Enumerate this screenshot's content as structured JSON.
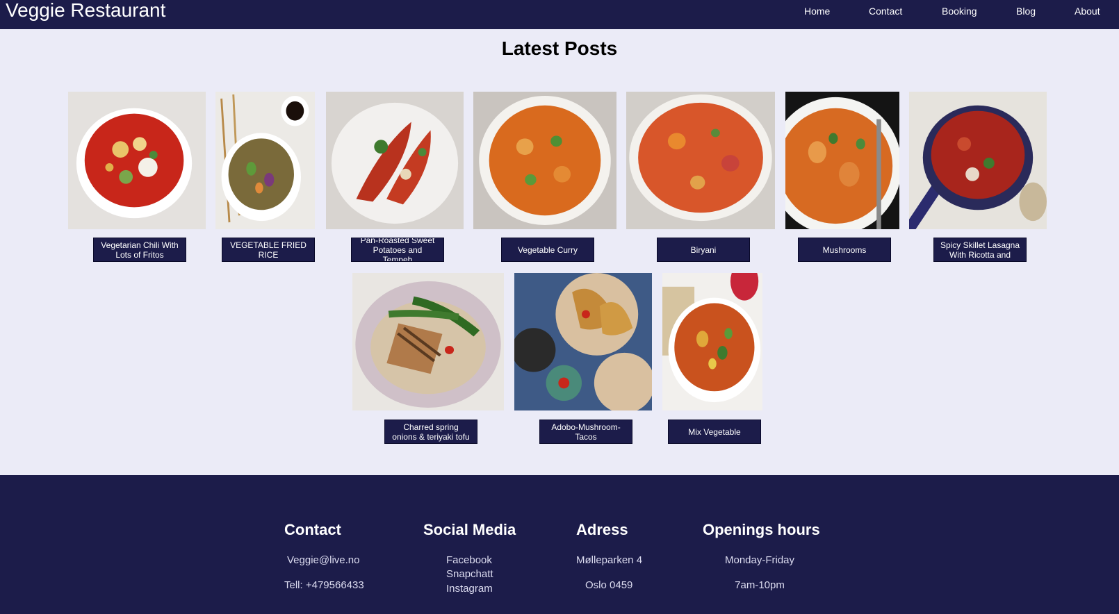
{
  "header": {
    "brand": "Veggie Restaurant",
    "nav": [
      "Home",
      "Contact",
      "Booking",
      "Blog",
      "About"
    ]
  },
  "main": {
    "title": "Latest Posts",
    "posts": [
      {
        "label": "Vegetarian Chili With Lots of Fritos",
        "image": "bowl-of-chili"
      },
      {
        "label": "VEGETABLE FRIED RICE",
        "image": "bowl-of-fried-rice-with-chopsticks"
      },
      {
        "label": "Pan-Roasted Sweet Potatoes and Tempeh",
        "image": "plate-of-roasted-sweet-potatoes"
      },
      {
        "label": "Vegetable Curry",
        "image": "bowl-of-vegetable-curry"
      },
      {
        "label": "Biryani",
        "image": "bowl-of-biryani"
      },
      {
        "label": "Mushrooms",
        "image": "bowl-of-mushroom-dish"
      },
      {
        "label": "Spicy Skillet Lasagna With Ricotta and Spinach",
        "image": "skillet-lasagna"
      },
      {
        "label": "Charred spring onions & teriyaki tofu",
        "image": "plate-of-tofu-with-spring-onions"
      },
      {
        "label": "Adobo-Mushroom-Tacos",
        "image": "plates-of-tacos"
      },
      {
        "label": "Mix Vegetable",
        "image": "bowl-of-mixed-vegetables"
      }
    ]
  },
  "footer": {
    "contact": {
      "heading": "Contact",
      "email": "Veggie@live.no",
      "phone": "Tell: +479566433"
    },
    "social": {
      "heading": "Social Media",
      "links": [
        "Facebook",
        "Snapchatt",
        "Instagram"
      ]
    },
    "address": {
      "heading": "Adress",
      "street": "Mølleparken 4",
      "city": "Oslo 0459"
    },
    "hours": {
      "heading": "Openings hours",
      "days": "Monday-Friday",
      "time": "7am-10pm"
    }
  },
  "colors": {
    "navy": "#1c1c4a",
    "page_background": "#ebebf7",
    "text_light": "#ffffff"
  }
}
